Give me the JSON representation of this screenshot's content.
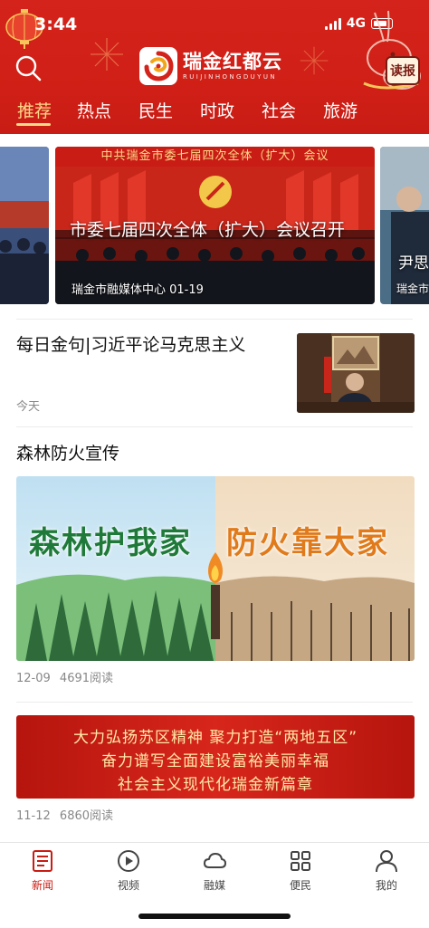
{
  "status": {
    "time": "3:44",
    "network": "4G"
  },
  "app": {
    "name_cn": "瑞金红都云",
    "name_en": "RUIJINHONGDUYUN",
    "read_button": "读报",
    "search_icon": "search-icon"
  },
  "tabs": [
    {
      "label": "推荐",
      "active": true
    },
    {
      "label": "热点",
      "active": false
    },
    {
      "label": "民生",
      "active": false
    },
    {
      "label": "时政",
      "active": false
    },
    {
      "label": "社会",
      "active": false
    },
    {
      "label": "旅游",
      "active": false
    }
  ],
  "carousel": {
    "main": {
      "banner": "中共瑞金市委七届四次全体（扩大）会议",
      "caption": "市委七届四次全体（扩大）会议召开",
      "meta": "瑞金市融媒体中心  01-19"
    },
    "right": {
      "caption": "尹思",
      "meta": "瑞金市"
    }
  },
  "news": [
    {
      "title": "每日金句|习近平论马克思主义",
      "date": "今天"
    },
    {
      "title": "森林防火宣传",
      "image_text_left": "森林护我家",
      "image_text_right": "防火靠大家",
      "date": "12-09",
      "reads": "4691阅读"
    },
    {
      "banner_lines": [
        "大力弘扬苏区精神  聚力打造“两地五区”",
        "奋力谱写全面建设富裕美丽幸福",
        "社会主义现代化瑞金新篇章"
      ],
      "date": "11-12",
      "reads": "6860阅读"
    }
  ],
  "bottom_nav": [
    {
      "label": "新闻",
      "icon": "news-icon",
      "active": true
    },
    {
      "label": "视频",
      "icon": "video-icon",
      "active": false
    },
    {
      "label": "融媒",
      "icon": "cloud-icon",
      "active": false
    },
    {
      "label": "便民",
      "icon": "grid-icon",
      "active": false
    },
    {
      "label": "我的",
      "icon": "user-icon",
      "active": false
    }
  ],
  "colors": {
    "brand_red": "#d3231a",
    "accent_gold": "#ffd98a",
    "active_nav": "#c81c14"
  }
}
